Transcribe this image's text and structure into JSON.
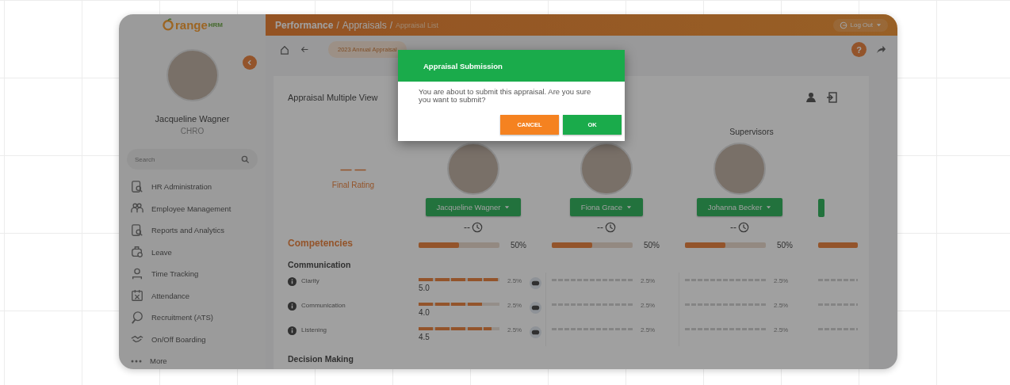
{
  "sidebar": {
    "logo": "range",
    "logo_suffix": "HRM",
    "user": {
      "name": "Jacqueline Wagner",
      "role": "CHRO"
    },
    "search": {
      "placeholder": "Search"
    },
    "items": [
      {
        "label": "HR Administration"
      },
      {
        "label": "Employee Management"
      },
      {
        "label": "Reports and Analytics"
      },
      {
        "label": "Leave"
      },
      {
        "label": "Time Tracking"
      },
      {
        "label": "Attendance"
      },
      {
        "label": "Recruitment (ATS)"
      },
      {
        "label": "On/Off Boarding"
      },
      {
        "label": "More"
      }
    ]
  },
  "header": {
    "breadcrumb": [
      "Performance",
      "Appraisals",
      "Appraisal List"
    ],
    "separator": "/",
    "logout": "Log Out"
  },
  "toolbar": {
    "appraisal": "2023 Annual Appraisal",
    "help": "?"
  },
  "panel": {
    "title": "Appraisal Multiple View",
    "cut_off_column": {
      "level": 1
    },
    "final_rating": {
      "value": "— —",
      "label": "Final Rating"
    },
    "section": "Competencies",
    "group": "Communication",
    "criteria": [
      "Clarity",
      "Communication",
      "Listening"
    ],
    "next_group": "Decision Making",
    "reviewers": [
      {
        "name": "Jacqueline Wagner",
        "score": "--",
        "percent": "50%",
        "level": 0.5,
        "scores": [
          {
            "kind": "rated",
            "level": 1,
            "value": "5.0",
            "weight": "2.5%"
          },
          {
            "kind": "rated",
            "level": 0.8,
            "value": "4.0",
            "weight": "2.5%"
          },
          {
            "kind": "rated",
            "level": 0.9,
            "value": "4.5",
            "weight": "2.5%"
          }
        ]
      },
      {
        "name": "Fiona Grace",
        "score": "--",
        "percent": "50%",
        "level": 0.5,
        "scores": [
          {
            "kind": "pending",
            "weight": "2.5%"
          },
          {
            "kind": "pending",
            "weight": "2.5%"
          },
          {
            "kind": "pending",
            "weight": "2.5%"
          }
        ]
      },
      {
        "name": "Johanna Becker",
        "group": "Supervisors",
        "score": "--",
        "percent": "50%",
        "level": 0.5,
        "scores": [
          {
            "kind": "pending",
            "weight": "2.5%"
          },
          {
            "kind": "pending",
            "weight": "2.5%"
          },
          {
            "kind": "pending",
            "weight": "2.5%"
          }
        ]
      }
    ]
  },
  "dialog": {
    "title": "Appraisal Submission",
    "message": "You are about to submit this appraisal. Are you sure you want to submit?",
    "buttons": [
      {
        "label": "CANCEL",
        "kind": "cancel"
      },
      {
        "label": "OK",
        "kind": "ok"
      }
    ]
  }
}
